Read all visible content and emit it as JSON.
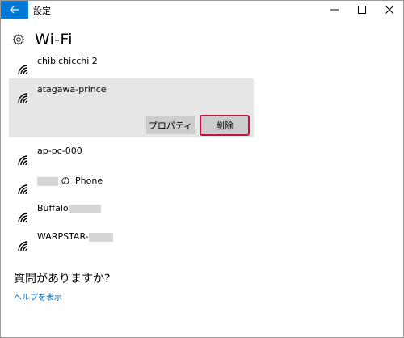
{
  "window": {
    "title": "設定"
  },
  "titlebar": {
    "back_icon": "arrow-left-icon",
    "minimize_icon": "minimize-icon",
    "maximize_icon": "maximize-icon",
    "close_icon": "close-icon",
    "accent_color": "#0078d7"
  },
  "header": {
    "icon": "gear-icon",
    "title": "Wi-Fi"
  },
  "networks": [
    {
      "name": "chibichicchi 2",
      "icon": "wifi-icon"
    },
    {
      "name": "atagawa-prince",
      "icon": "wifi-icon",
      "selected": true,
      "properties_label": "プロパティ",
      "delete_label": "削除"
    },
    {
      "name": "ap-pc-000",
      "icon": "wifi-icon"
    },
    {
      "name_suffix": "の iPhone",
      "icon": "wifi-icon"
    },
    {
      "name_prefix": "Buffalo",
      "icon": "wifi-icon"
    },
    {
      "name_prefix": "WARPSTAR-",
      "icon": "wifi-icon"
    }
  ],
  "help": {
    "heading": "質問がありますか?",
    "link": "ヘルプを表示"
  },
  "colors": {
    "selected_bg": "#e6e6e6",
    "delete_outline": "#c0143c",
    "link": "#0063b1"
  }
}
